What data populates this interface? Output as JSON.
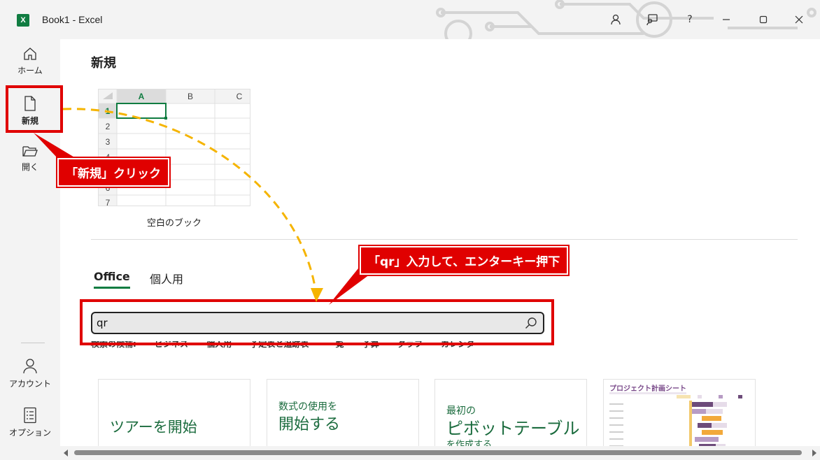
{
  "window": {
    "title": "Book1  -  Excel",
    "logo_letter": "X"
  },
  "titlebar": {
    "help": "?"
  },
  "rail": {
    "home": "ホーム",
    "new": "新規",
    "open": "開く",
    "account": "アカウント",
    "options": "オプション"
  },
  "main": {
    "title": "新規",
    "blank_workbook": "空白のブック",
    "grid": {
      "cols": [
        "A",
        "B",
        "C"
      ],
      "rows": [
        "1",
        "2",
        "3",
        "4",
        "5",
        "6",
        "7"
      ]
    },
    "tabs": [
      {
        "label": "Office"
      },
      {
        "label": "個人用"
      }
    ],
    "search": {
      "value": "qr"
    },
    "suggested_label": "検索の候補:",
    "suggestions": [
      "ビジネス",
      "個人用",
      "予定表と追跡表",
      "一覧",
      "予算",
      "グラフ",
      "カレンダー"
    ],
    "cards": [
      {
        "line1": "",
        "line2": "ツアーを開始"
      },
      {
        "line1": "数式の使用を",
        "line2": "開始する"
      },
      {
        "line1": "最初の",
        "line2": "ピボットテーブル",
        "line3": "を作成する"
      },
      {
        "title": "プロジェクト計画シート"
      }
    ]
  },
  "annotations": {
    "callout1": "「新規」クリック",
    "callout2": "「qr」入力して、エンターキー押下"
  },
  "colors": {
    "accent": "#107c41",
    "annotation": "#e00000",
    "arrow": "#f5b400"
  }
}
